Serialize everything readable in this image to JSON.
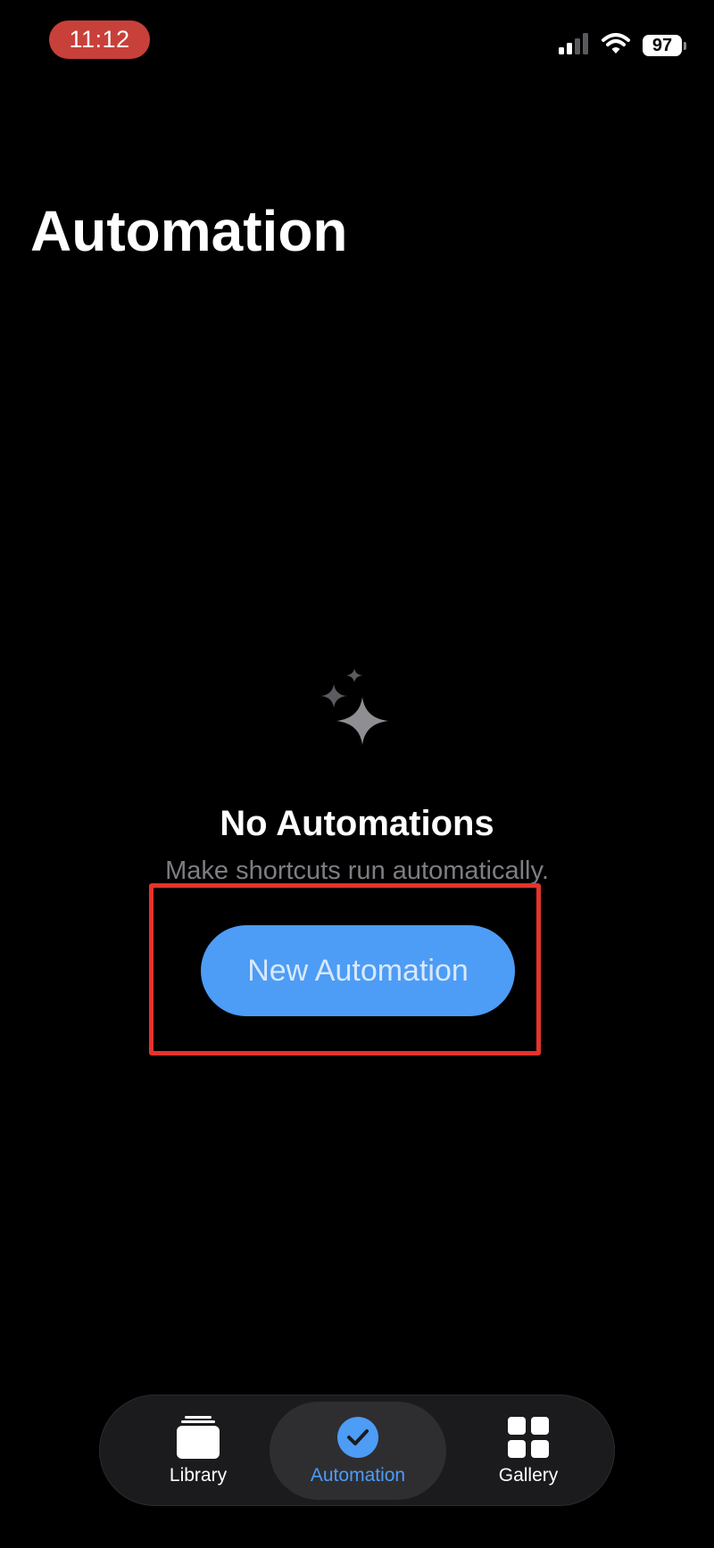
{
  "status_bar": {
    "time": "11:12",
    "battery": "97"
  },
  "page": {
    "title": "Automation"
  },
  "empty_state": {
    "icon": "sparkles-icon",
    "title": "No Automations",
    "subtitle": "Make shortcuts run automatically.",
    "button_label": "New Automation"
  },
  "tab_bar": {
    "items": [
      {
        "label": "Library",
        "icon": "library-icon"
      },
      {
        "label": "Automation",
        "icon": "automation-clock-icon",
        "selected": true
      },
      {
        "label": "Gallery",
        "icon": "gallery-grid-icon"
      }
    ]
  },
  "colors": {
    "background": "#000000",
    "accent": "#4d9cf6",
    "highlight_box": "#e5332c",
    "time_pill": "#c8403a"
  }
}
